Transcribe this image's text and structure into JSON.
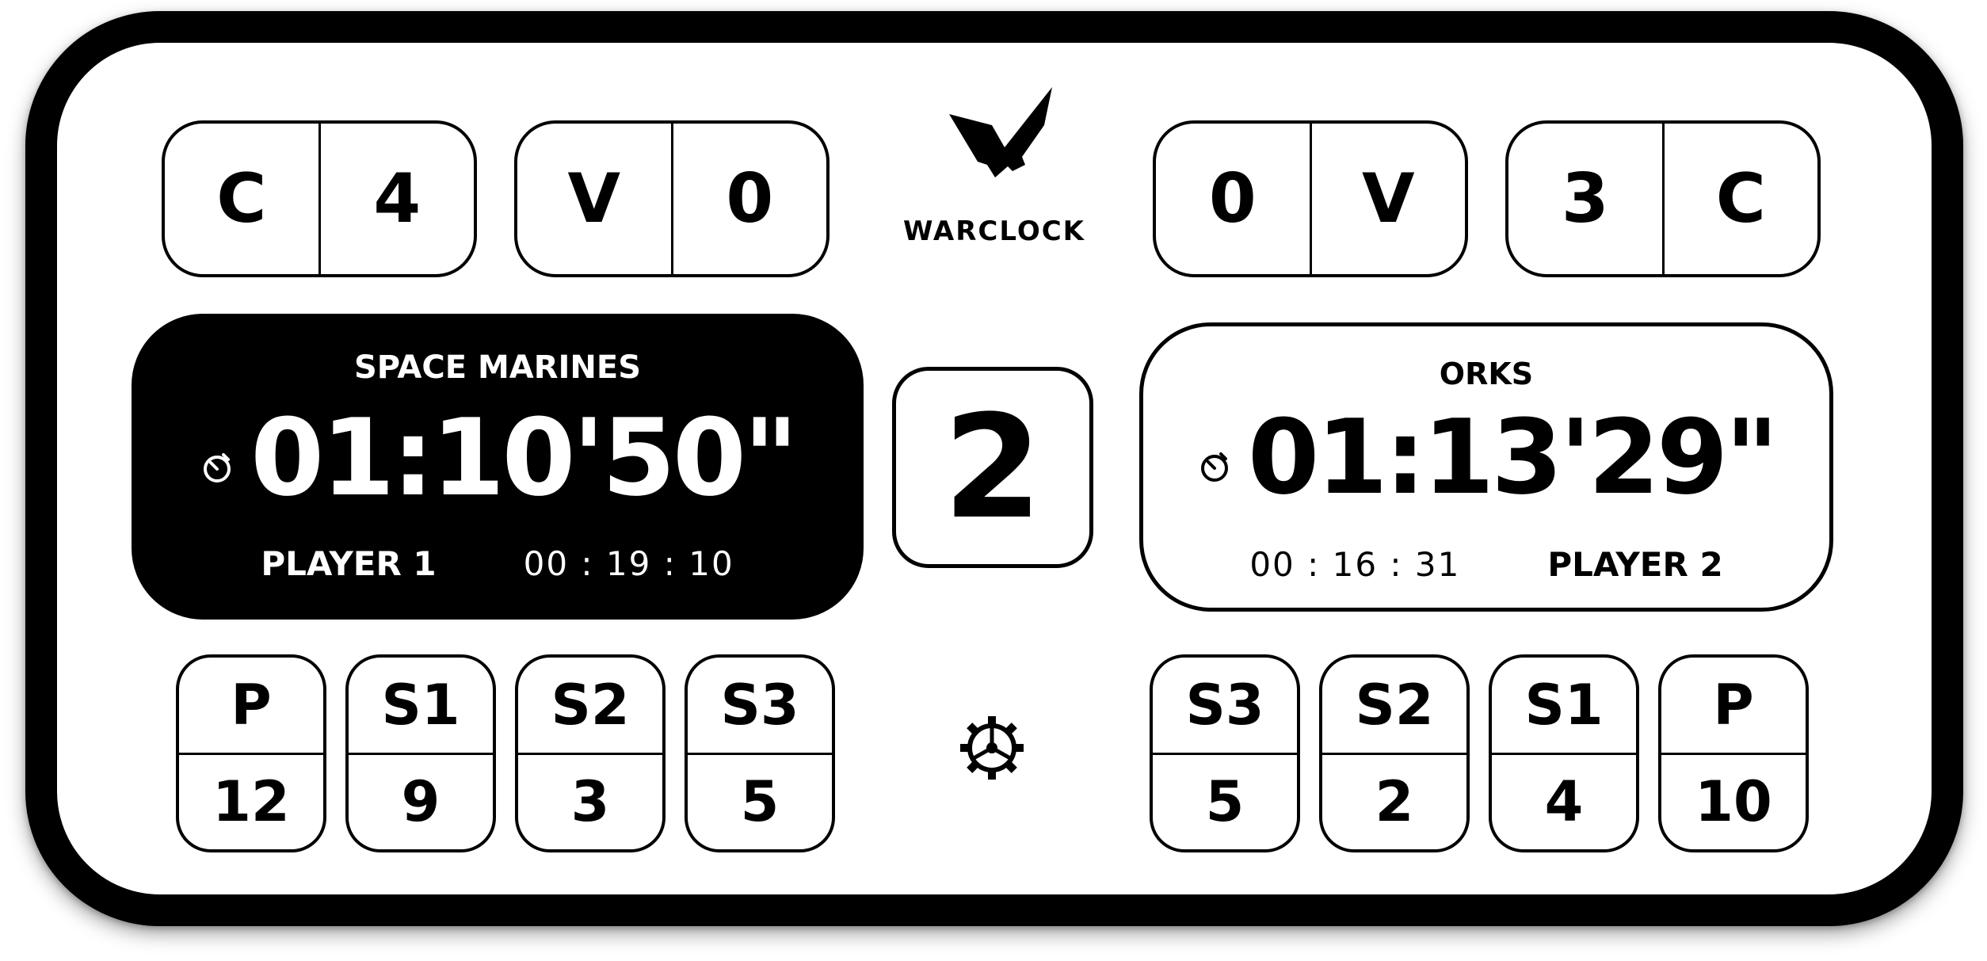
{
  "brand": {
    "name": "WARCLOCK"
  },
  "left_counters": [
    {
      "label": "C",
      "value": "4"
    },
    {
      "label": "V",
      "value": "0"
    }
  ],
  "right_counters": [
    {
      "value": "0",
      "label": "V"
    },
    {
      "value": "3",
      "label": "C"
    }
  ],
  "player1": {
    "faction": "SPACE MARINES",
    "clock": "01:10'50\"",
    "name": "PLAYER 1",
    "turn_time": "00 : 19 : 10",
    "active": true
  },
  "player2": {
    "faction": "ORKS",
    "clock": "01:13'29\"",
    "name": "PLAYER 2",
    "turn_time": "00 : 16 : 31",
    "active": false
  },
  "round": "2",
  "left_scores": [
    {
      "label": "P",
      "value": "12"
    },
    {
      "label": "S1",
      "value": "9"
    },
    {
      "label": "S2",
      "value": "3"
    },
    {
      "label": "S3",
      "value": "5"
    }
  ],
  "right_scores": [
    {
      "label": "S3",
      "value": "5"
    },
    {
      "label": "S2",
      "value": "2"
    },
    {
      "label": "S1",
      "value": "4"
    },
    {
      "label": "P",
      "value": "10"
    }
  ],
  "colors": {
    "foreground": "#000000",
    "background": "#ffffff"
  },
  "icons": [
    "warclock-logo-icon",
    "stopwatch-icon",
    "gear-icon"
  ]
}
